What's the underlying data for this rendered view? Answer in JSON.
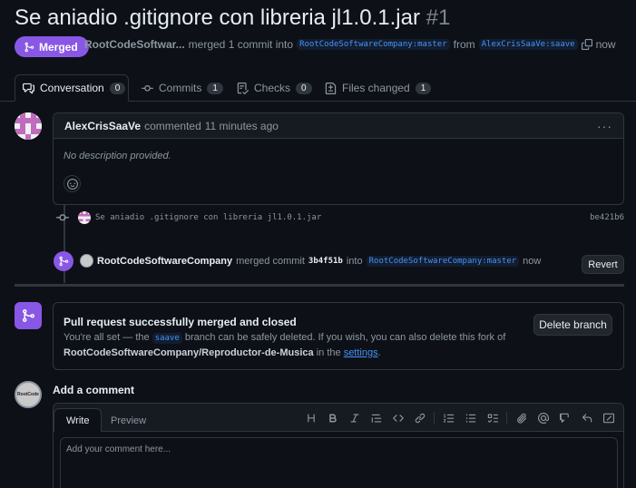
{
  "pr": {
    "title": "Se aniadio .gitignore con libreria jl1.0.1.jar",
    "number": "#1",
    "state_label": "Merged",
    "author": "RootCodeSoftwar...",
    "merged_text": "merged 1 commit into",
    "base_branch": "RootCodeSoftwareCompany:master",
    "from_text": "from",
    "head_branch": "AlexCrisSaaVe:saave",
    "time": "now"
  },
  "tabs": [
    {
      "label": "Conversation",
      "count": "0",
      "icon": "comment-discussion-icon"
    },
    {
      "label": "Commits",
      "count": "1",
      "icon": "git-commit-icon"
    },
    {
      "label": "Checks",
      "count": "0",
      "icon": "checklist-icon"
    },
    {
      "label": "Files changed",
      "count": "1",
      "icon": "file-diff-icon"
    }
  ],
  "comment": {
    "author": "AlexCrisSaaVe",
    "action": "commented",
    "time": "11 minutes ago",
    "body": "No description provided.",
    "menu": "···"
  },
  "commit": {
    "message": "Se aniadio .gitignore con libreria jl1.0.1.jar",
    "sha": "be421b6"
  },
  "merge_event": {
    "actor": "RootCodeSoftwareCompany",
    "text": "merged commit",
    "sha": "3b4f51b",
    "into": "into",
    "branch": "RootCodeSoftwareCompany:master",
    "time": "now",
    "revert_label": "Revert"
  },
  "merged_box": {
    "title": "Pull request successfully merged and closed",
    "line1_a": "You're all set — the",
    "branch": "saave",
    "line1_b": "branch can be safely deleted. If you wish, you can also delete this fork of",
    "repo": "RootCodeSoftwareCompany/Reproductor-de-Musica",
    "line2_a": "in the",
    "settings_link": "settings",
    "line2_b": ".",
    "delete_label": "Delete branch"
  },
  "add_comment": {
    "title": "Add a comment",
    "tab_write": "Write",
    "tab_preview": "Preview",
    "placeholder": "Add your comment here...",
    "avatar_text_1": "RootCode"
  },
  "colors": {
    "merged": "#8957e5",
    "link": "#4493f8",
    "bg": "#0d1117"
  }
}
